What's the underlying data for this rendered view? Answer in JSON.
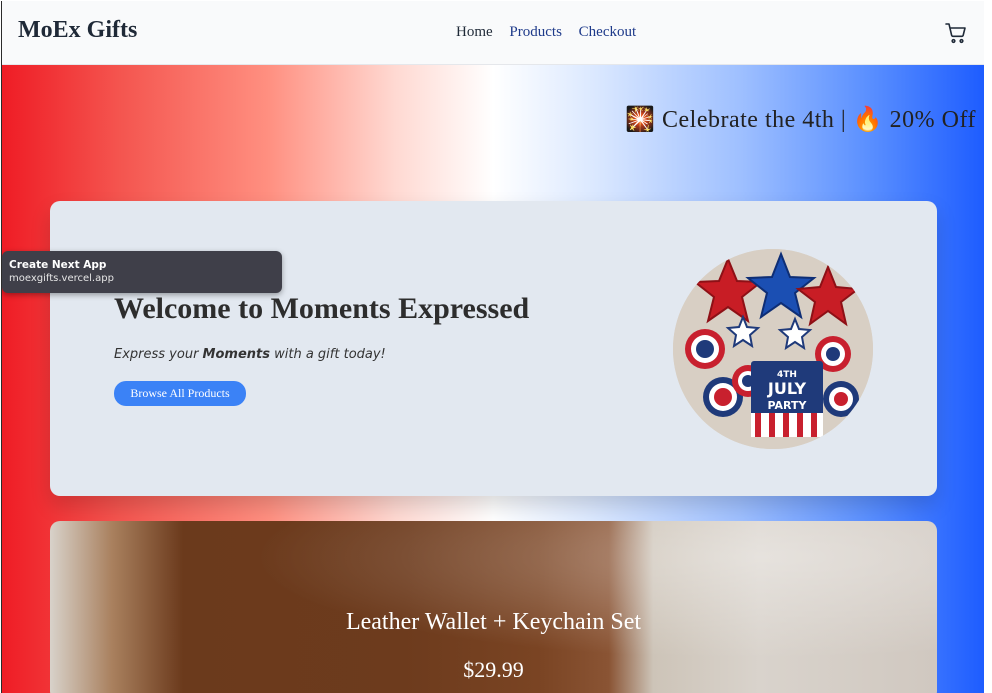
{
  "navbar": {
    "brand": "MoEx Gifts",
    "links": [
      "Home",
      "Products",
      "Checkout"
    ],
    "cart_icon": "cart-icon"
  },
  "banner": {
    "text": "🎇 Celebrate the 4th | 🔥 20% Off"
  },
  "hero": {
    "title": "Welcome to Moments Expressed",
    "tagline_before": "Express your ",
    "tagline_bold": "Moments",
    "tagline_after": " with a gift today!",
    "button_label": "Browse All Products",
    "image_text_top": "4TH",
    "image_text_middle": "JULY",
    "image_text_bottom": "PARTY"
  },
  "tooltip": {
    "title": "Create Next App",
    "url": "moexgifts.vercel.app"
  },
  "product": {
    "name": "Leather Wallet + Keychain Set",
    "price": "$29.99"
  },
  "colors": {
    "accent": "#3b82f6",
    "red": "#ef1c25",
    "blue": "#1d5cff",
    "nav_link": "#1e3a8a"
  }
}
